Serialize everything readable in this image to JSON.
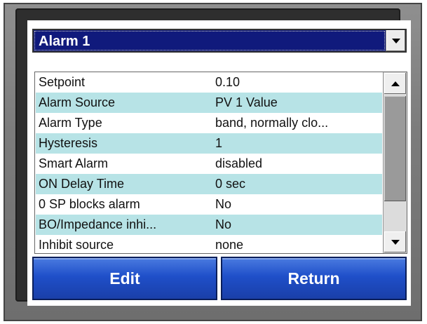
{
  "alarm_select": {
    "selected": "Alarm 1"
  },
  "parameters": [
    {
      "name": "Setpoint",
      "value": "0.10"
    },
    {
      "name": "Alarm Source",
      "value": "PV 1 Value"
    },
    {
      "name": "Alarm Type",
      "value": "band, normally clo..."
    },
    {
      "name": "Hysteresis",
      "value": "1"
    },
    {
      "name": "Smart Alarm",
      "value": "disabled"
    },
    {
      "name": "ON Delay Time",
      "value": "0 sec"
    },
    {
      "name": "0 SP blocks alarm",
      "value": "No"
    },
    {
      "name": "BO/Impedance inhi...",
      "value": "No"
    },
    {
      "name": "Inhibit source",
      "value": "none"
    }
  ],
  "buttons": {
    "edit_label": "Edit",
    "return_label": "Return"
  },
  "colors": {
    "dropdown_bg": "#101a7c",
    "row_alt": "#b7e3e6",
    "button_blue": "#1f4fc9"
  },
  "icons": {
    "dropdown": "chevron-down-icon",
    "scroll_up": "scroll-up-icon",
    "scroll_down": "scroll-down-icon"
  }
}
